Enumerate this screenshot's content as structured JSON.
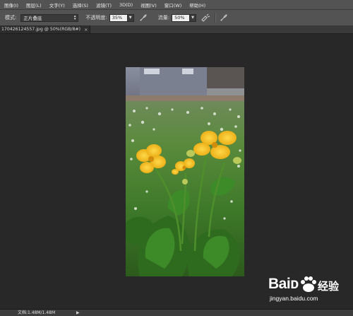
{
  "menu": {
    "items": [
      "图像(I)",
      "图层(L)",
      "文字(Y)",
      "选择(S)",
      "滤镜(T)",
      "3D(D)",
      "视图(V)",
      "窗口(W)",
      "帮助(H)"
    ]
  },
  "options": {
    "mode_label": "模式:",
    "mode_value": "正片叠底",
    "opacity_label": "不透明度:",
    "opacity_value": "35%",
    "flow_label": "流量:",
    "flow_value": "50%"
  },
  "tab": {
    "title": "170426124557.jpg @ 50%(RGB/8#)",
    "close": "×"
  },
  "status": {
    "doc_size": "文档:1.48M/1.48M",
    "arrow": "▶"
  },
  "watermark": {
    "brand": "Baiᴅ",
    "brand_cn": "经验",
    "url": "jingyan.baidu.com"
  },
  "colors": {
    "panel": "#535353",
    "canvas": "#282828",
    "flower": "#f4c21a"
  }
}
